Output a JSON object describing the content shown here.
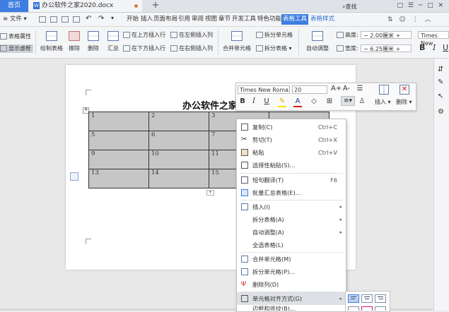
{
  "title_bar": {
    "home_tab": "首页",
    "doc_tab": "办公软件之家2020.docx",
    "doc_icon": "W",
    "add_tab": "+",
    "window_controls": "□ ☰ ─ □ ✕"
  },
  "menu_bar": {
    "file_menu": "≡ 文件 ▾",
    "tabs": [
      "开始",
      "插入",
      "页面布局",
      "引用",
      "审阅",
      "视图",
      "章节",
      "开发工具",
      "特色功能",
      "表格工具",
      "表格样式"
    ],
    "active_tab": "表格工具",
    "search_label": "查找"
  },
  "ribbon": {
    "table_props": "表格属性",
    "show_grid": "显示虚框",
    "draw_table": "绘制表格",
    "erase": "擦除",
    "delete": "删除",
    "summarize": "汇总",
    "insert_above": "在上方插入行",
    "insert_below": "在下方插入行",
    "insert_left": "在左侧插入列",
    "insert_right": "在右侧插入列",
    "merge_cells": "合并单元格",
    "split_cells": "拆分单元格",
    "split_table": "拆分表格",
    "auto_fit": "自动调整",
    "height_label": "高度:",
    "height_value": "2.00厘米",
    "width_label": "宽度:",
    "width_value": "6.25厘米",
    "font_name": "Times New",
    "bold": "B",
    "italic": "I",
    "underline": "U"
  },
  "document": {
    "title": "办公软件之家",
    "table": [
      [
        "1",
        "2",
        "3",
        ""
      ],
      [
        "5",
        "6",
        "7",
        ""
      ],
      [
        "9",
        "10",
        "11",
        ""
      ],
      [
        "13",
        "14",
        "15",
        ""
      ]
    ]
  },
  "float_toolbar": {
    "font_name": "Times New Roma",
    "font_size": "20",
    "grow_font": "A+",
    "shrink_font": "A-",
    "bold": "B",
    "italic": "I",
    "underline": "U",
    "insert": "插入",
    "delete": "删除"
  },
  "context_menu": {
    "items": [
      {
        "label": "复制(C)",
        "shortcut": "Ctrl+C"
      },
      {
        "label": "剪切(T)",
        "shortcut": "Ctrl+X"
      },
      {
        "label": "粘贴",
        "shortcut": "Ctrl+V"
      },
      {
        "label": "选择性粘贴(S)...",
        "shortcut": ""
      },
      {
        "label": "短句翻译(T)",
        "shortcut": "F6"
      },
      {
        "label": "批量汇总表格(E)...",
        "shortcut": ""
      },
      {
        "label": "插入(I)",
        "shortcut": ""
      },
      {
        "label": "拆分表格(A)",
        "shortcut": ""
      },
      {
        "label": "自动调整(A)",
        "shortcut": ""
      },
      {
        "label": "全选表格(L)",
        "shortcut": ""
      },
      {
        "label": "合并单元格(M)",
        "shortcut": ""
      },
      {
        "label": "拆分单元格(P)...",
        "shortcut": ""
      },
      {
        "label": "删除列(D)",
        "shortcut": ""
      },
      {
        "label": "单元格对齐方式(G)",
        "shortcut": ""
      },
      {
        "label": "边框和底纹(B)...",
        "shortcut": ""
      }
    ]
  },
  "colors": {
    "accent": "#3d7ee0",
    "table_fill": "#c6c6c6",
    "hover": "#dde0e4"
  }
}
